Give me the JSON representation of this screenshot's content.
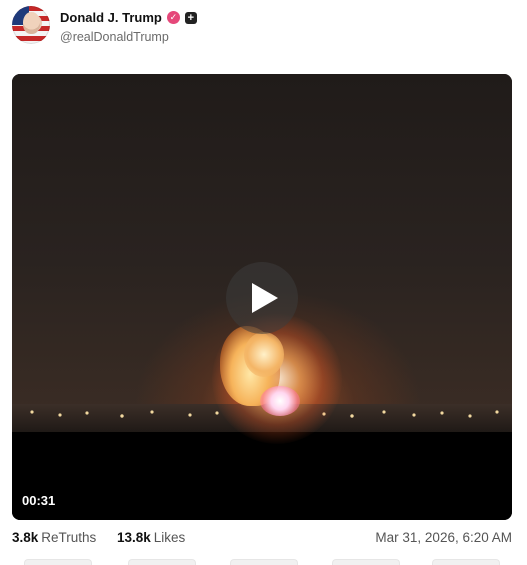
{
  "post": {
    "author_name": "Donald J. Trump",
    "handle": "@realDonaldTrump",
    "verified_icon": "verified-check-icon",
    "plus_icon": "plus-badge-icon",
    "colors": {
      "verified": "#e5487a",
      "plus_badge": "#222222"
    }
  },
  "media": {
    "duration": "00:31",
    "play_icon": "play-icon"
  },
  "stats": {
    "retruths_count": "3.8k",
    "retruths_label": "ReTruths",
    "likes_count": "13.8k",
    "likes_label": "Likes",
    "timestamp": "Mar 31, 2026, 6:20 AM"
  }
}
